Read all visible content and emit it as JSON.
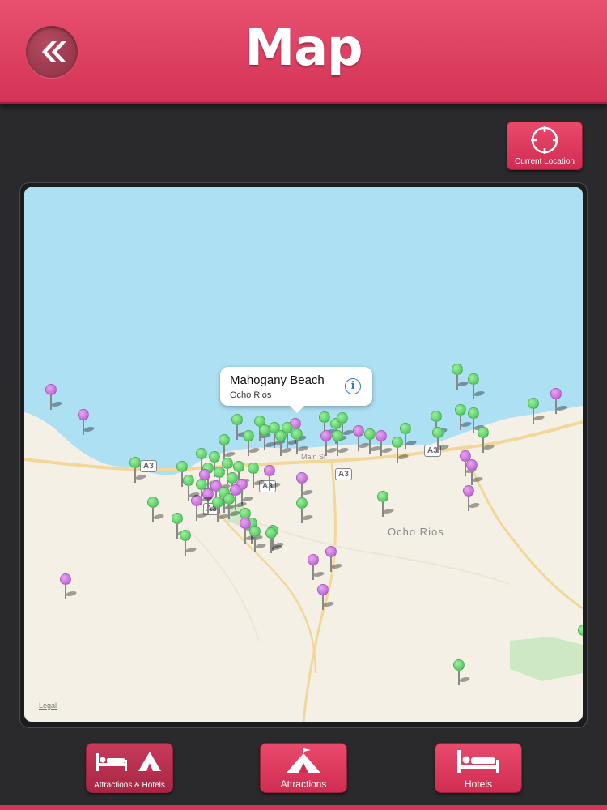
{
  "header": {
    "title": "Map",
    "back_icon": "double-chevron-left-icon"
  },
  "current_location": {
    "label": "Current Location",
    "icon": "crosshair-icon"
  },
  "map": {
    "legal_label": "Legal",
    "town_label": "Ocho Rios",
    "street_label": "Main St",
    "road_labels": [
      "A3",
      "A3",
      "A3",
      "A3",
      "A3"
    ],
    "callout": {
      "title": "Mahogany Beach",
      "subtitle": "Ocho Rios",
      "info_icon": "info-icon"
    },
    "water_color": "#aee0f4",
    "land_color": "#f4f0e6",
    "pin_colors": {
      "attraction": "#5fd46a",
      "hotel": "#c46ad9"
    }
  },
  "tabs": [
    {
      "label": "Attractions & Hotels",
      "icon": "bed-and-tent-icon"
    },
    {
      "label": "Attractions",
      "icon": "tent-icon"
    },
    {
      "label": "Hotels",
      "icon": "bed-icon"
    }
  ]
}
